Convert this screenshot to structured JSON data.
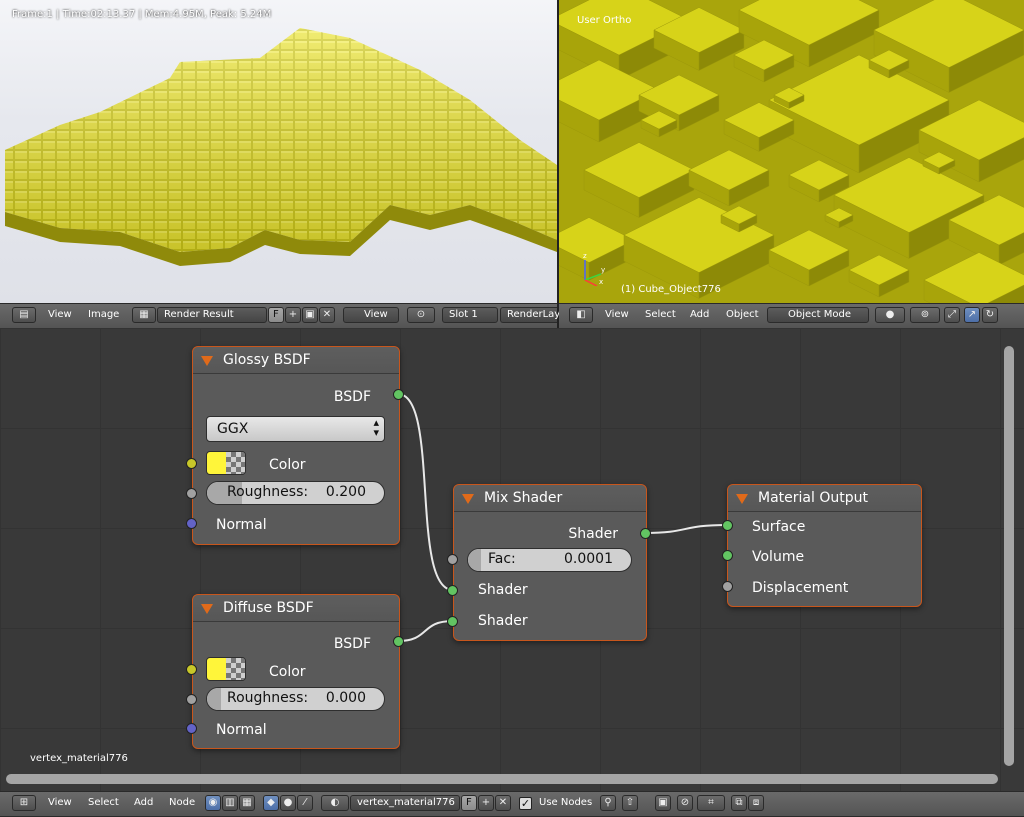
{
  "image_editor": {
    "render_info": "Frame:1 | Time:02:13.37 | Mem:4.95M, Peak: 5.24M",
    "header": {
      "menu": [
        "View",
        "Image"
      ],
      "image_name": "Render Result",
      "fake_user": "F",
      "view_label": "View",
      "slot_label": "Slot 1",
      "layer_label": "RenderLaye"
    }
  },
  "viewport_3d": {
    "view_mode": "User Ortho",
    "active_object": "(1) Cube_Object776",
    "header": {
      "menu": [
        "View",
        "Select",
        "Add",
        "Object"
      ],
      "mode": "Object Mode"
    }
  },
  "node_editor": {
    "material_label": "vertex_material776",
    "nodes": {
      "glossy": {
        "title": "Glossy BSDF",
        "output": "BSDF",
        "distribution": "GGX",
        "color_label": "Color",
        "color": "#fff53a",
        "roughness_label": "Roughness:",
        "roughness_value": "0.200",
        "normal_label": "Normal"
      },
      "diffuse": {
        "title": "Diffuse BSDF",
        "output": "BSDF",
        "color_label": "Color",
        "color": "#fff53a",
        "roughness_label": "Roughness:",
        "roughness_value": "0.000",
        "normal_label": "Normal"
      },
      "mix": {
        "title": "Mix Shader",
        "output": "Shader",
        "fac_label": "Fac:",
        "fac_value": "0.0001",
        "input1": "Shader",
        "input2": "Shader"
      },
      "output": {
        "title": "Material Output",
        "surface": "Surface",
        "volume": "Volume",
        "displacement": "Displacement"
      }
    },
    "header": {
      "menu": [
        "View",
        "Select",
        "Add",
        "Node"
      ],
      "material_name": "vertex_material776",
      "fake_user": "F",
      "use_nodes_label": "Use Nodes",
      "use_nodes": true
    }
  },
  "colors": {
    "node_border": "#c8561c",
    "shader_socket": "#62c462",
    "color_socket": "#c7c729",
    "value_socket": "#a1a1a1",
    "vector_socket": "#6363c7",
    "material_yellow": "#fff53a"
  }
}
